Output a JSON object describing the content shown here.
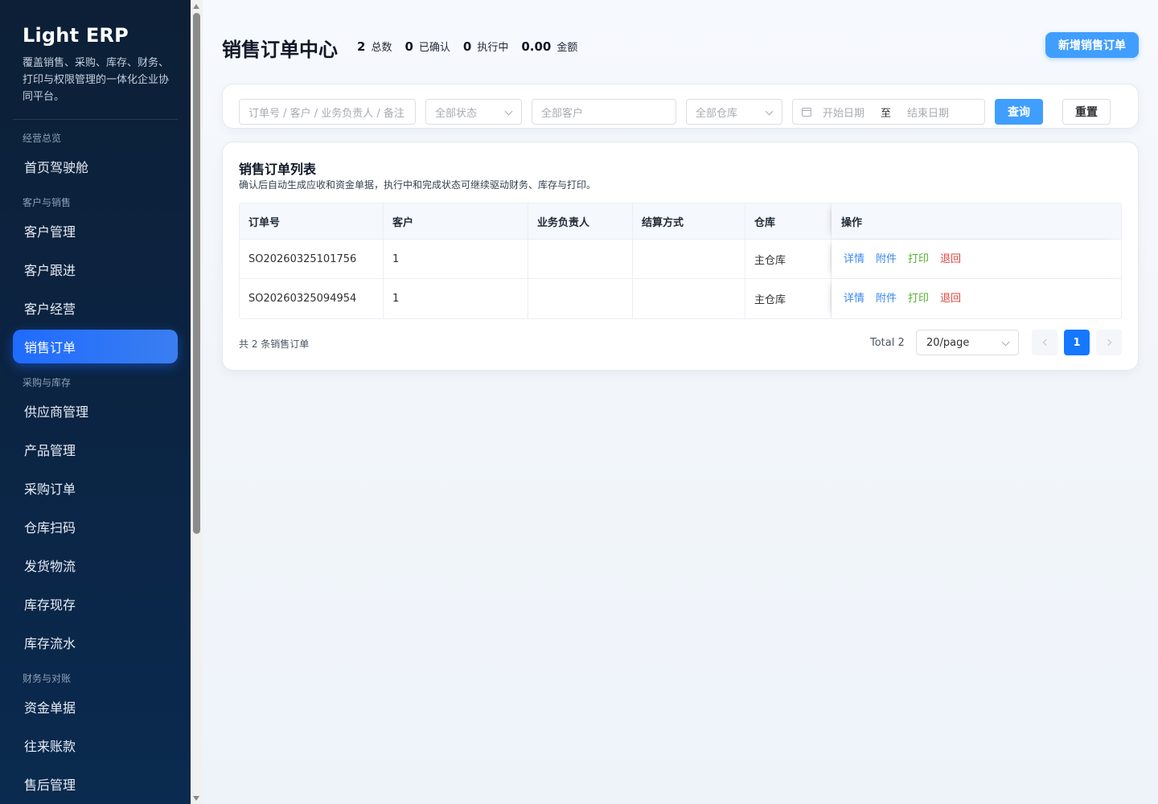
{
  "sidebar": {
    "brand": "Light ERP",
    "description": "覆盖销售、采购、库存、财务、打印与权限管理的一体化企业协同平台。",
    "groups": {
      "overview": "经营总览",
      "sales": "客户与销售",
      "purchase": "采购与库存",
      "finance": "财务与对账"
    },
    "items": {
      "dashboard": "首页驾驶舱",
      "customers": "客户管理",
      "followup": "客户跟进",
      "operation": "客户经营",
      "sales_orders": "销售订单",
      "suppliers": "供应商管理",
      "products": "产品管理",
      "purchase_orders": "采购订单",
      "warehouse_scan": "仓库扫码",
      "shipping": "发货物流",
      "inventory": "库存现存",
      "inventory_flow": "库存流水",
      "fund_docs": "资金单据",
      "accounts": "往来账款",
      "after_sales": "售后管理"
    }
  },
  "header": {
    "title": "销售订单中心",
    "stats": {
      "total_value": "2",
      "total_label": "总数",
      "confirmed_value": "0",
      "confirmed_label": "已确认",
      "executing_value": "0",
      "executing_label": "执行中",
      "amount_value": "0.00",
      "amount_label": "金额"
    },
    "add_button": "新增销售订单"
  },
  "filters": {
    "search_placeholder": "订单号 / 客户 / 业务负责人 / 备注",
    "status_placeholder": "全部状态",
    "customer_placeholder": "全部客户",
    "warehouse_placeholder": "全部仓库",
    "start_date_placeholder": "开始日期",
    "range_separator": "至",
    "end_date_placeholder": "结束日期",
    "query_button": "查询",
    "reset_button": "重置"
  },
  "list": {
    "title": "销售订单列表",
    "description": "确认后自动生成应收和资金单据，执行中和完成状态可继续驱动财务、库存与打印。",
    "columns": {
      "order_no": "订单号",
      "customer": "客户",
      "owner": "业务负责人",
      "settlement": "结算方式",
      "warehouse": "仓库",
      "actions": "操作"
    },
    "rows": [
      {
        "order_no": "SO20260325101756",
        "customer": "1",
        "owner": "",
        "settlement": "",
        "warehouse": "主仓库"
      },
      {
        "order_no": "SO20260325094954",
        "customer": "1",
        "owner": "",
        "settlement": "",
        "warehouse": "主仓库"
      }
    ],
    "actions": {
      "detail": "详情",
      "attachment": "附件",
      "print": "打印",
      "return": "退回"
    }
  },
  "pagination": {
    "note": "共 2 条销售订单",
    "total": "Total 2",
    "page_size": "20/page",
    "current_page": "1"
  },
  "colors": {
    "sidebar_bg": "#0c1f36",
    "accent": "#409eff",
    "active_nav": "#1f6bff",
    "action_blue": "#3a87f0",
    "action_green": "#52b12c",
    "action_red": "#e0473f"
  }
}
